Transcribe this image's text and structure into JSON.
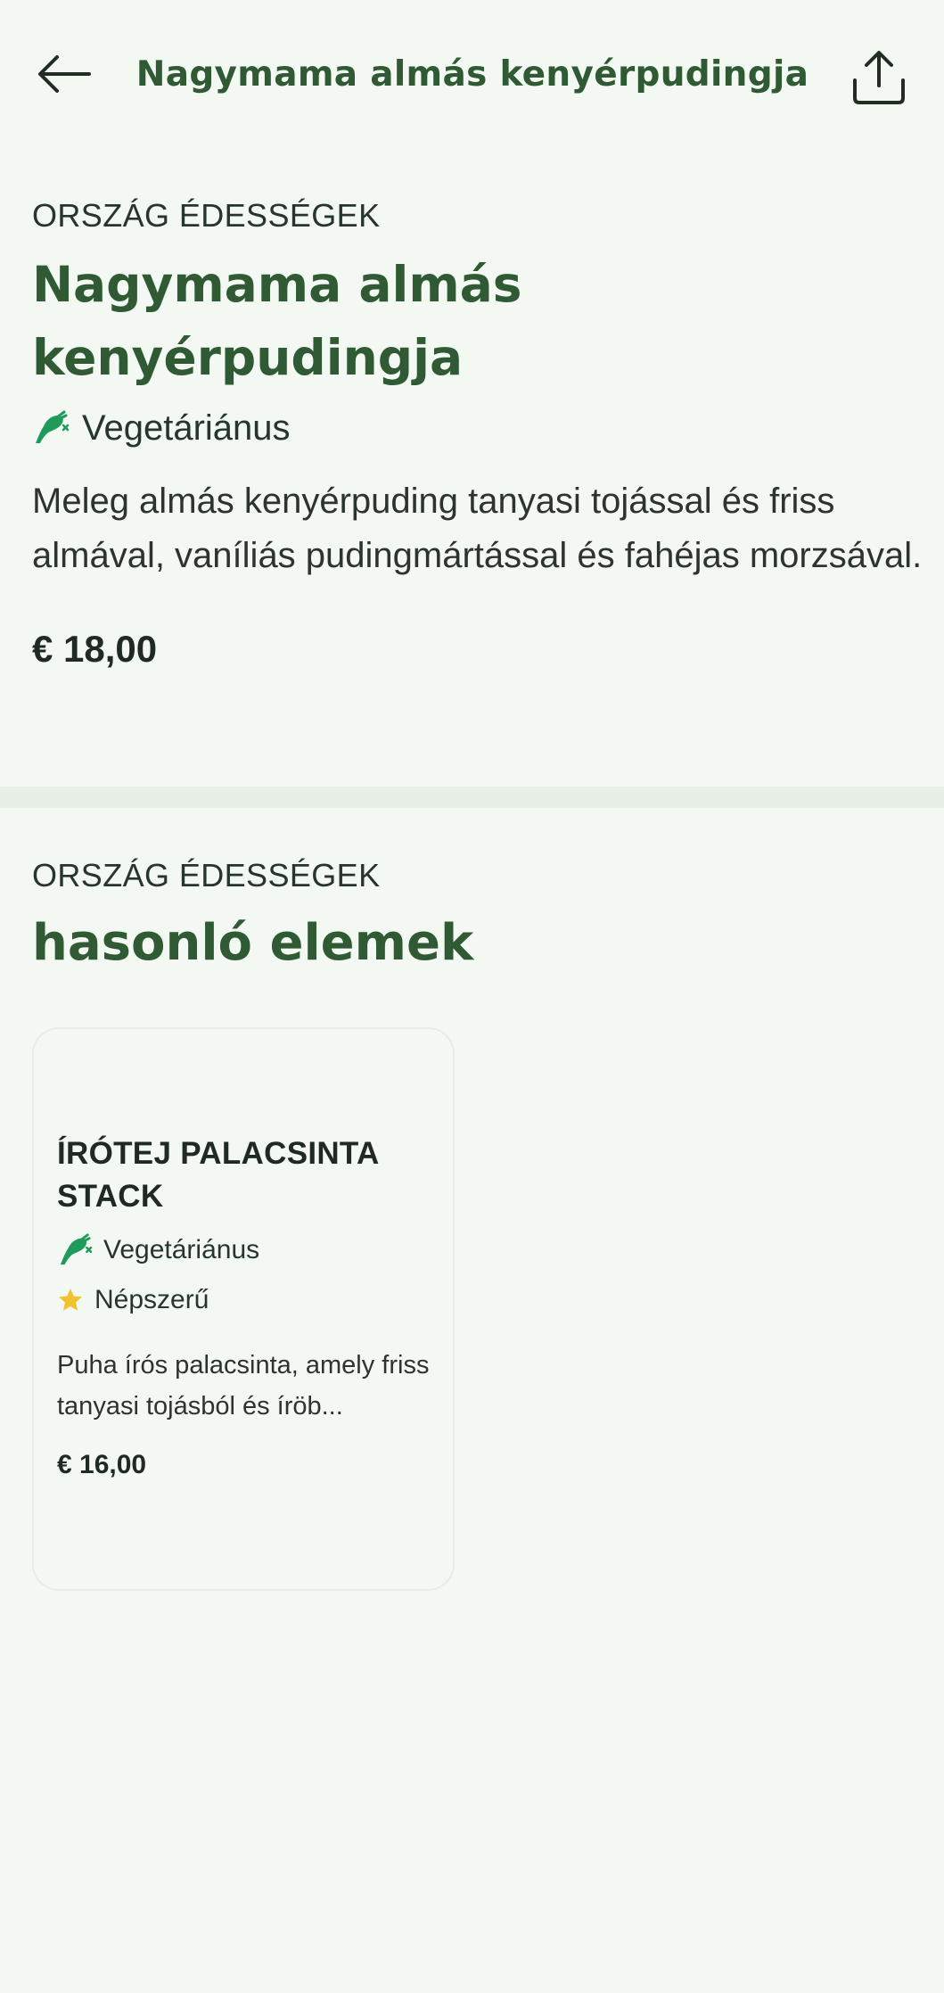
{
  "header": {
    "title": "Nagymama almás kenyérpudingja",
    "back_icon": "arrow-left-icon",
    "share_icon": "share-icon"
  },
  "product": {
    "category": "ORSZÁG ÉDESSÉGEK",
    "title": "Nagymama almás kenyérpudingja",
    "diet_label": "Vegetáriánus",
    "description": "Meleg almás kenyérpuding tanyasi tojással és friss almával, vaníliás pudingmártással és fahéjas morzsával.",
    "price": "€ 18,00"
  },
  "similar": {
    "category": "ORSZÁG ÉDESSÉGEK",
    "title": "hasonló elemek",
    "items": [
      {
        "title": "ÍRÓTEJ PALACSINTA STACK",
        "diet_label": "Vegetáriánus",
        "popular_label": "Népszerű",
        "description": "Puha írós palacsinta, amely friss tanyasi tojásból és íröb...",
        "price": "€ 16,00"
      }
    ]
  },
  "colors": {
    "background": "#f3f8f2",
    "brand_green": "#2f5a34",
    "icon_green": "#1f9a5b",
    "star_yellow": "#f2c12e"
  }
}
